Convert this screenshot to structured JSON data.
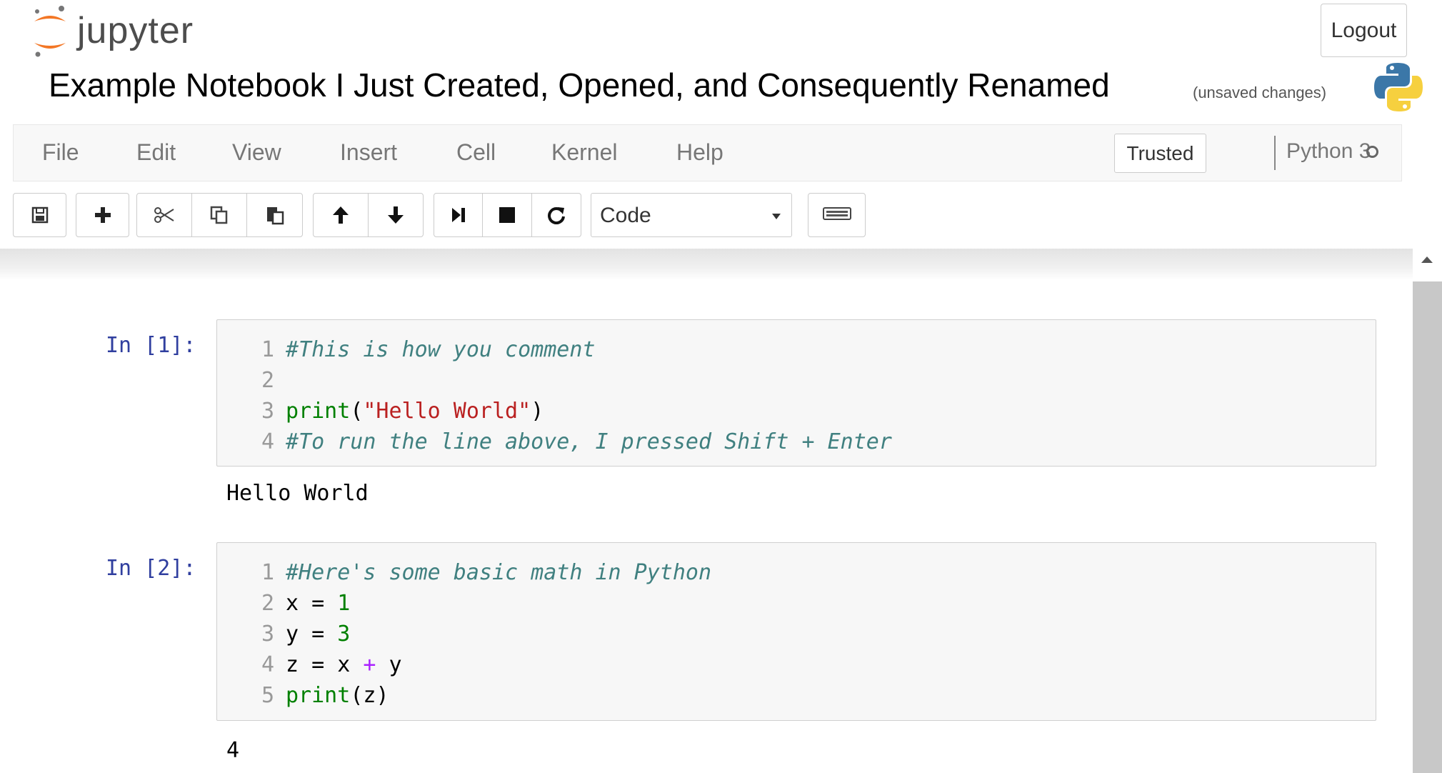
{
  "header": {
    "logo_text": "jupyter",
    "logout_label": "Logout",
    "notebook_title": "Example Notebook I Just Created, Opened, and Consequently Renamed",
    "save_status": "(unsaved changes)"
  },
  "menubar": {
    "items": [
      "File",
      "Edit",
      "View",
      "Insert",
      "Cell",
      "Kernel",
      "Help"
    ],
    "trusted_label": "Trusted",
    "kernel_name": "Python 3"
  },
  "toolbar": {
    "buttons": [
      "save-icon",
      "plus-icon",
      "cut-icon",
      "copy-icon",
      "paste-icon",
      "arrow-up-icon",
      "arrow-down-icon",
      "run-icon",
      "stop-icon",
      "restart-icon",
      "keyboard-icon"
    ],
    "cell_type": "Code"
  },
  "cells": [
    {
      "prompt": "In [1]:",
      "lines": [
        {
          "n": "1",
          "text": "#This is how you comment"
        },
        {
          "n": "2",
          "text": ""
        },
        {
          "n": "3",
          "text": "print(\"Hello World\")"
        },
        {
          "n": "4",
          "text": "#To run the line above, I pressed Shift + Enter"
        }
      ],
      "output": "Hello World"
    },
    {
      "prompt": "In [2]:",
      "lines": [
        {
          "n": "1",
          "text": "#Here's some basic math in Python"
        },
        {
          "n": "2",
          "text": "x = 1"
        },
        {
          "n": "3",
          "text": "y = 3"
        },
        {
          "n": "4",
          "text": "z = x + y"
        },
        {
          "n": "5",
          "text": "print(z)"
        }
      ],
      "output": "4"
    }
  ],
  "colors": {
    "prompt": "#303F9F",
    "comment": "#408080",
    "keyword": "#008000",
    "string": "#BA2121",
    "operator": "#AA22FF",
    "logo_orange": "#F37726"
  }
}
